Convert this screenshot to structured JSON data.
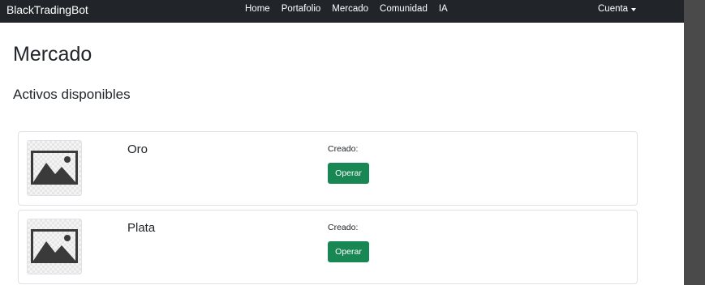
{
  "navbar": {
    "brand": "BlackTradingBot",
    "links": [
      "Home",
      "Portafolio",
      "Mercado",
      "Comunidad",
      "IA"
    ],
    "account_label": "Cuenta"
  },
  "page": {
    "title": "Mercado",
    "section_title": "Activos disponibles"
  },
  "assets": [
    {
      "name": "Oro",
      "created_label": "Creado:",
      "action_label": "Operar",
      "image_icon": "image-placeholder-icon"
    },
    {
      "name": "Plata",
      "created_label": "Creado:",
      "action_label": "Operar",
      "image_icon": "image-placeholder-icon"
    }
  ],
  "colors": {
    "navbar_bg": "#212529",
    "button_green": "#198754",
    "scrollbar": "#4a4a4a"
  }
}
